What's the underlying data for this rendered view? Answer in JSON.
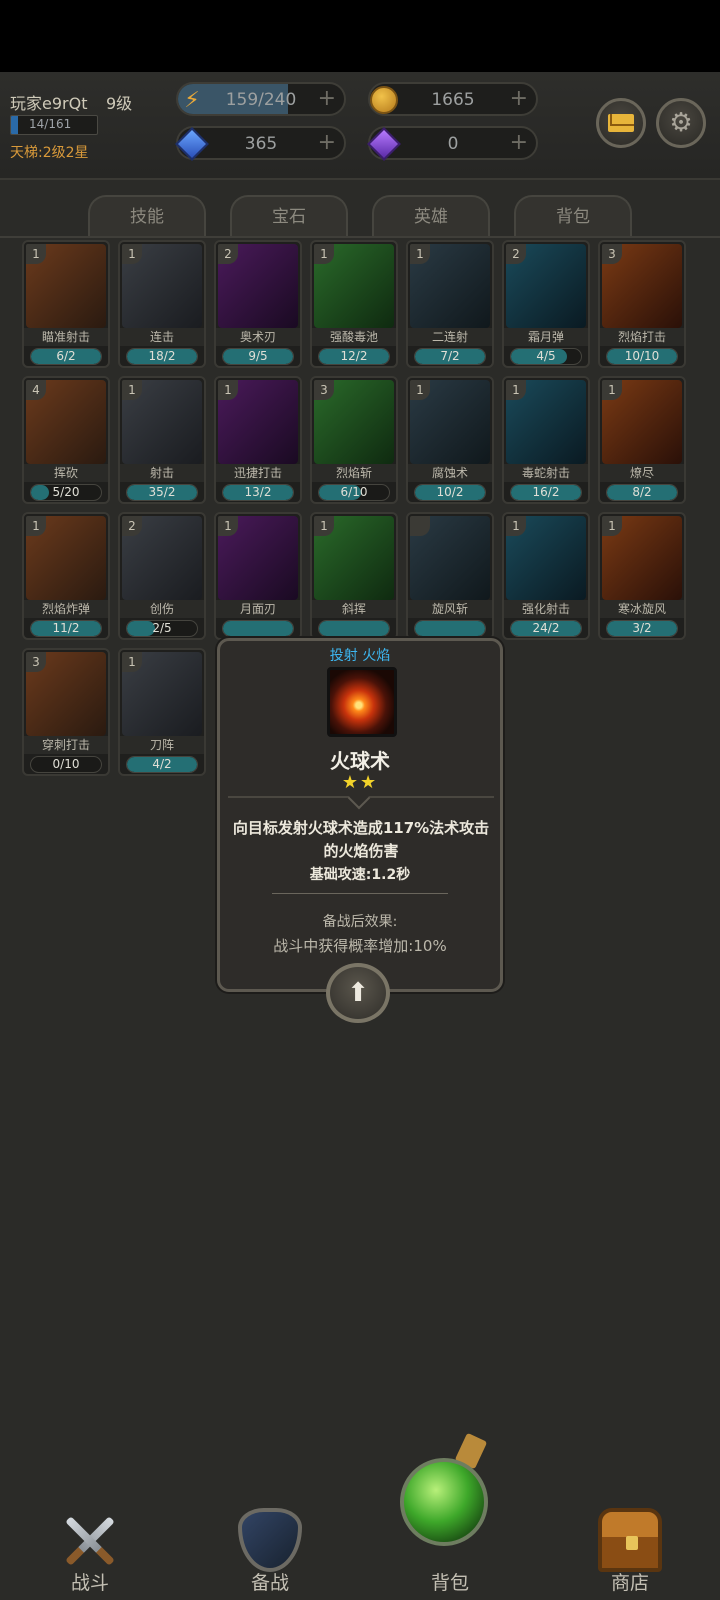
{
  "player": {
    "name": "玩家e9rQt",
    "level": "9级",
    "xp_text": "14/161",
    "xp_fraction": 0.087,
    "ladder": "天梯:2级2星"
  },
  "resources": {
    "energy": {
      "icon": "lightning-icon",
      "value": "159/240",
      "fill_fraction": 0.66,
      "plus": "+"
    },
    "coins": {
      "icon": "coin-icon",
      "value": "1665",
      "plus": "+"
    },
    "blue_gems": {
      "icon": "blue-gem-icon",
      "value": "365",
      "plus": "+"
    },
    "purple_gems": {
      "icon": "purple-gem-icon",
      "value": "0",
      "plus": "+"
    }
  },
  "buttons": {
    "mail_icon": "mail-icon",
    "settings_icon": "gear-icon"
  },
  "tabs": [
    "技能",
    "宝石",
    "英雄",
    "背包"
  ],
  "skills": [
    {
      "level": "1",
      "name": "瞄准射击",
      "progress": "6/2",
      "fill": 1.0
    },
    {
      "level": "1",
      "name": "连击",
      "progress": "18/2",
      "fill": 1.0
    },
    {
      "level": "2",
      "name": "奥术刃",
      "progress": "9/5",
      "fill": 1.0
    },
    {
      "level": "1",
      "name": "强酸毒池",
      "progress": "12/2",
      "fill": 1.0
    },
    {
      "level": "1",
      "name": "二连射",
      "progress": "7/2",
      "fill": 1.0
    },
    {
      "level": "2",
      "name": "霜月弹",
      "progress": "4/5",
      "fill": 0.8
    },
    {
      "level": "3",
      "name": "烈焰打击",
      "progress": "10/10",
      "fill": 1.0
    },
    {
      "level": "4",
      "name": "挥砍",
      "progress": "5/20",
      "fill": 0.25
    },
    {
      "level": "1",
      "name": "射击",
      "progress": "35/2",
      "fill": 1.0
    },
    {
      "level": "1",
      "name": "迅捷打击",
      "progress": "13/2",
      "fill": 1.0
    },
    {
      "level": "3",
      "name": "烈焰斩",
      "progress": "6/10",
      "fill": 0.6
    },
    {
      "level": "1",
      "name": "腐蚀术",
      "progress": "10/2",
      "fill": 1.0
    },
    {
      "level": "1",
      "name": "毒蛇射击",
      "progress": "16/2",
      "fill": 1.0
    },
    {
      "level": "1",
      "name": "燎尽",
      "progress": "8/2",
      "fill": 1.0
    },
    {
      "level": "1",
      "name": "烈焰炸弹",
      "progress": "11/2",
      "fill": 1.0
    },
    {
      "level": "2",
      "name": "创伤",
      "progress": "2/5",
      "fill": 0.4
    },
    {
      "level": "1",
      "name": "月面刃",
      "progress": "",
      "fill": 1.0
    },
    {
      "level": "1",
      "name": "斜挥",
      "progress": "",
      "fill": 1.0
    },
    {
      "level": "",
      "name": "旋风斩",
      "progress": "",
      "fill": 1.0
    },
    {
      "level": "1",
      "name": "强化射击",
      "progress": "24/2",
      "fill": 1.0
    },
    {
      "level": "1",
      "name": "寒冰旋风",
      "progress": "3/2",
      "fill": 1.0
    },
    {
      "level": "3",
      "name": "穿刺打击",
      "progress": "0/10",
      "fill": 0.0
    },
    {
      "level": "1",
      "name": "刀阵",
      "progress": "4/2",
      "fill": 1.0
    }
  ],
  "tooltip": {
    "tags": "投射 火焰",
    "name": "火球术",
    "stars": "★★",
    "description": "向目标发射火球术造成117%法术攻击的火焰伤害",
    "attack_speed": "基础攻速:1.2秒",
    "bonus_title": "备战后效果:",
    "bonus_text": "战斗中获得概率增加:10%",
    "upgrade_icon": "up-arrow-icon"
  },
  "navbar": [
    {
      "label": "战斗",
      "icon": "crossed-swords-icon"
    },
    {
      "label": "备战",
      "icon": "shield-icon"
    },
    {
      "label": "背包",
      "icon": "potion-icon"
    },
    {
      "label": "商店",
      "icon": "treasure-chest-icon"
    }
  ]
}
